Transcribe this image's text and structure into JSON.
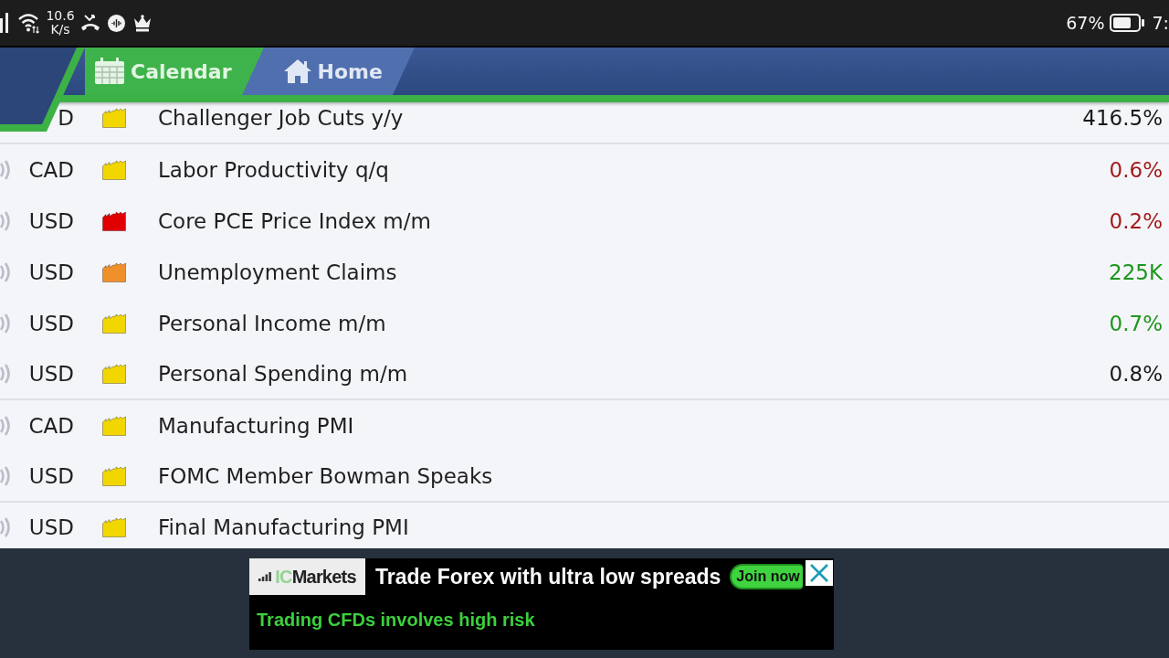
{
  "status_bar": {
    "speed_value": "10.6",
    "speed_unit": "K/s",
    "battery": "67%",
    "time": "7:"
  },
  "tabs": [
    {
      "label": "Calendar",
      "kind": "calendar",
      "selected": true
    },
    {
      "label": "Home",
      "kind": "home",
      "selected": false
    }
  ],
  "calendar": {
    "groups": [
      {
        "rows": [
          {
            "currency": "D",
            "impact": {
              "color": "#f2d600"
            },
            "event": "Challenger Job Cuts y/y",
            "actual": {
              "text": "416.5%",
              "color": "#1a1a1a"
            }
          }
        ]
      },
      {
        "rows": [
          {
            "currency": "CAD",
            "impact": {
              "color": "#f2d600"
            },
            "event": "Labor Productivity q/q",
            "actual": {
              "text": "0.6%",
              "color": "#a31c1c"
            }
          },
          {
            "currency": "USD",
            "impact": {
              "color": "#e00000"
            },
            "event": "Core PCE Price Index m/m",
            "actual": {
              "text": "0.2%",
              "color": "#a31c1c"
            }
          },
          {
            "currency": "USD",
            "impact": {
              "color": "#f0902a"
            },
            "event": "Unemployment Claims",
            "actual": {
              "text": "225K",
              "color": "#1c961c"
            }
          },
          {
            "currency": "USD",
            "impact": {
              "color": "#f2d600"
            },
            "event": "Personal Income m/m",
            "actual": {
              "text": "0.7%",
              "color": "#1c961c"
            }
          },
          {
            "currency": "USD",
            "impact": {
              "color": "#f2d600"
            },
            "event": "Personal Spending m/m",
            "actual": {
              "text": "0.8%",
              "color": "#1a1a1a"
            }
          }
        ]
      },
      {
        "rows": [
          {
            "currency": "CAD",
            "impact": {
              "color": "#f2d600"
            },
            "event": "Manufacturing PMI"
          },
          {
            "currency": "USD",
            "impact": {
              "color": "#f2d600"
            },
            "event": "FOMC Member Bowman Speaks"
          }
        ]
      },
      {
        "rows": [
          {
            "currency": "USD",
            "impact": {
              "color": "#f2d600"
            },
            "event": "Final Manufacturing PMI"
          }
        ]
      }
    ]
  },
  "ad": {
    "logo": [
      "IC",
      "Markets"
    ],
    "headline": "Trade Forex with ultra low spreads",
    "button": "Join now",
    "disclaimer": "Trading CFDs involves high risk"
  }
}
